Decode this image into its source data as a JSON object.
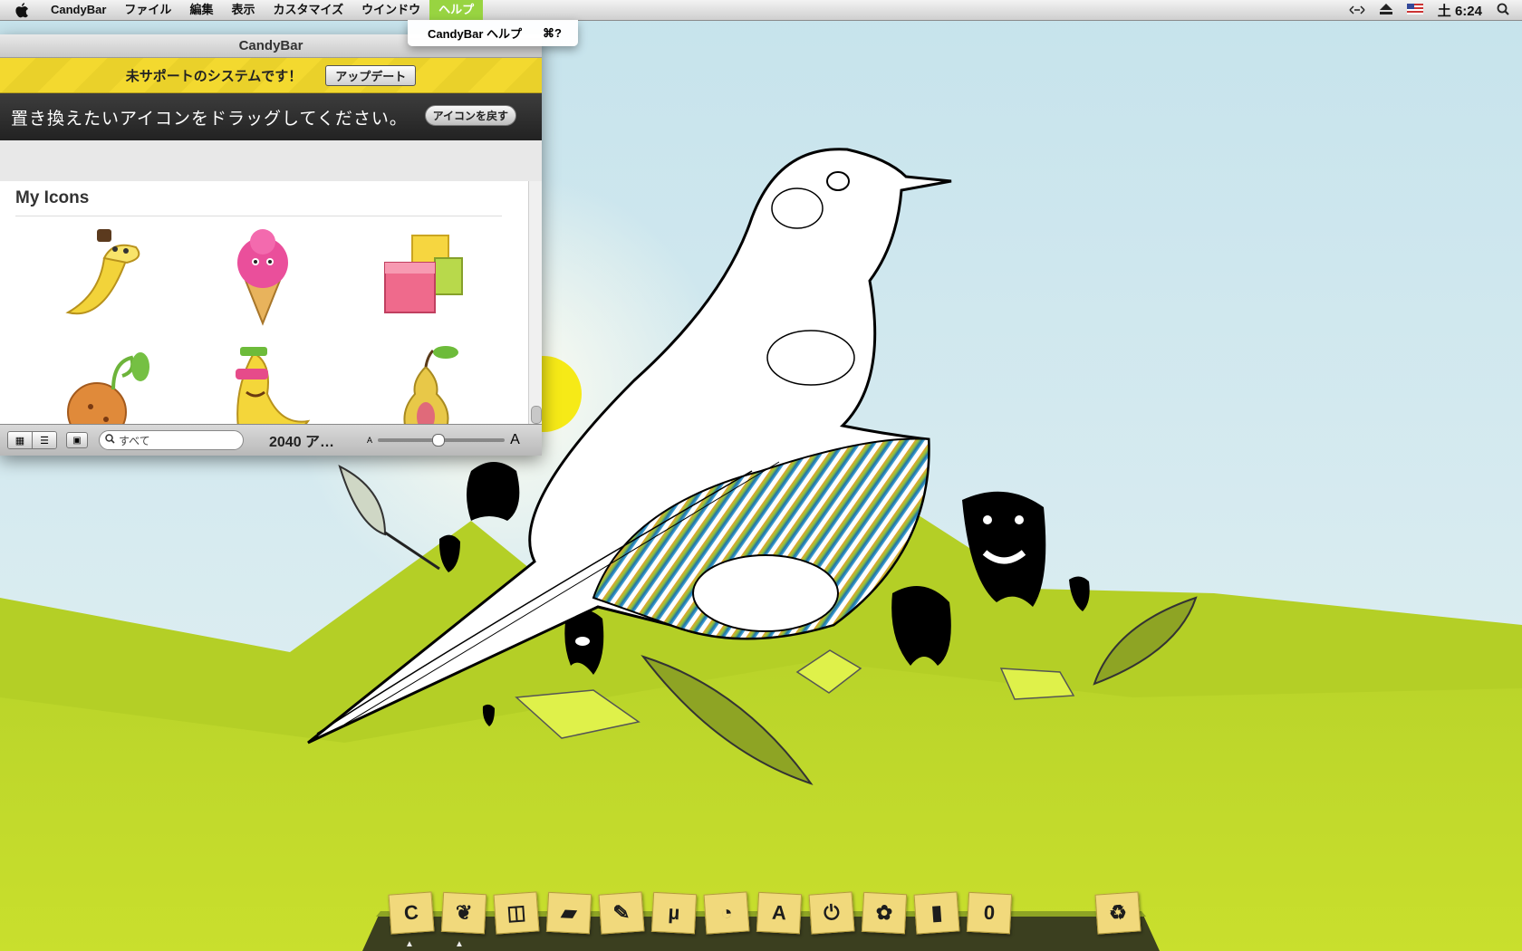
{
  "menubar": {
    "app_name": "CandyBar",
    "menus": [
      "ファイル",
      "編集",
      "表示",
      "カスタマイズ",
      "ウインドウ",
      "ヘルプ"
    ],
    "clock": "土 6:24",
    "status_icons": [
      "network-icon",
      "eject-icon",
      "us-flag-icon",
      "spotlight-icon"
    ]
  },
  "help_menu": {
    "item_label": "CandyBar ヘルプ",
    "item_shortcut": "⌘?"
  },
  "window": {
    "title": "CandyBar",
    "warning_text": "未サポートのシステムです！",
    "update_button": "アップデート",
    "drop_prompt": "置き換えたいアイコンをドラッグしてください。",
    "restore_button": "アイコンを戻す",
    "section_title": "My Icons",
    "icons": [
      "banana-character-icon",
      "ice-cream-icon",
      "candy-cubes-icon",
      "sprout-fruit-icon",
      "cool-banana-icon",
      "pear-icon"
    ],
    "footer": {
      "search_placeholder": "すべて",
      "count": "2040 ア…",
      "zoom_level": 0.47
    }
  },
  "dock": {
    "items": [
      "C",
      "❦",
      "◫",
      "▰",
      "✎",
      "µ",
      "◔",
      "A",
      "⏻",
      "✿",
      "▮",
      "0"
    ],
    "item_names": [
      "candybar",
      "fox-app",
      "preview",
      "folder",
      "pen",
      "utorrent",
      "chrome",
      "font-book",
      "power",
      "pawprint",
      "notebook",
      "opera"
    ],
    "trash_label": "♻"
  },
  "colors": {
    "menu_highlight": "#98d441",
    "warning_yellow": "#f3d92f",
    "grass": "#c3da2a",
    "sky": "#cfe6ee"
  }
}
